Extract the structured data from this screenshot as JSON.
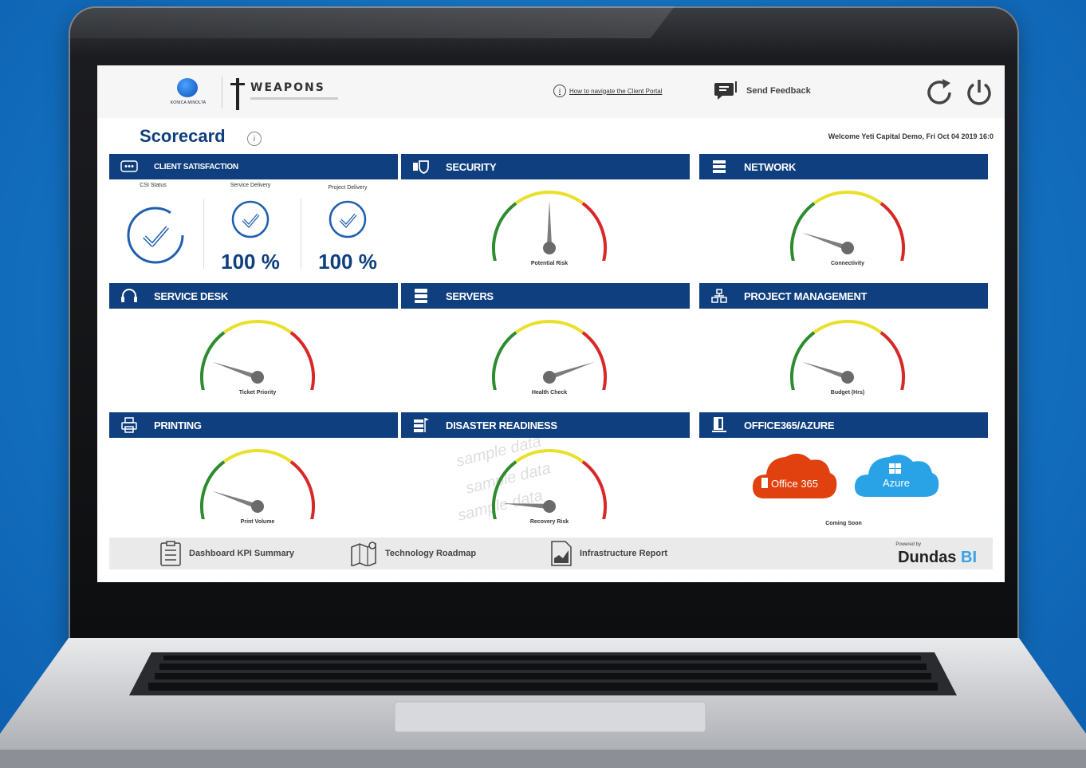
{
  "header": {
    "brand_left": "KONICA MINOLTA",
    "brand_right": "WEAPONS",
    "help_icon": "info-icon",
    "help_link": "How to navigate the Client Portal",
    "feedback_label": "Send Feedback",
    "feedback_icon": "chat-icon",
    "refresh_icon": "refresh-icon",
    "power_icon": "power-icon"
  },
  "title": {
    "text": "Scorecard",
    "info_glyph": "i",
    "welcome": "Welcome Yeti Capital Demo, Fri Oct 04 2019 16:0"
  },
  "colors": {
    "panel_header": "#0f3f7e",
    "gauge_green": "#2e8b2e",
    "gauge_yellow": "#e8e02a",
    "gauge_red": "#d92626",
    "office365": "#e0410f",
    "azure": "#2aa3e6"
  },
  "panels": {
    "client_satisfaction": {
      "title": "CLIENT SATISFACTION",
      "csi_label": "CSI Status",
      "service_label": "Service Delivery",
      "service_value": "100 %",
      "project_label": "Project Delivery",
      "project_value": "100 %"
    },
    "security": {
      "title": "SECURITY",
      "gauge_label": "Potential Risk",
      "level": 0.5
    },
    "network": {
      "title": "NETWORK",
      "gauge_label": "Connectivity",
      "level": 0.17
    },
    "service_desk": {
      "title": "SERVICE DESK",
      "gauge_label": "Ticket Priority",
      "level": 0.17
    },
    "servers": {
      "title": "SERVERS",
      "gauge_label": "Health Check",
      "level": 0.83
    },
    "project_management": {
      "title": "PROJECT MANAGEMENT",
      "gauge_label": "Budget (Hrs)",
      "level": 0.17
    },
    "printing": {
      "title": "PRINTING",
      "gauge_label": "Print Volume",
      "level": 0.17
    },
    "disaster_readiness": {
      "title": "DISASTER READINESS",
      "gauge_label": "Recovery Risk",
      "level": 0.1,
      "watermark": "sample data"
    },
    "office365_azure": {
      "title": "OFFICE365/AZURE",
      "office_label": "Office 365",
      "azure_label": "Azure",
      "status": "Coming Soon"
    }
  },
  "footer": {
    "items": [
      "Dashboard KPI Summary",
      "Technology Roadmap",
      "Infrastructure Report"
    ],
    "powered_by": "Powered by",
    "brand": "Dundas",
    "brand_suffix": "BI"
  }
}
